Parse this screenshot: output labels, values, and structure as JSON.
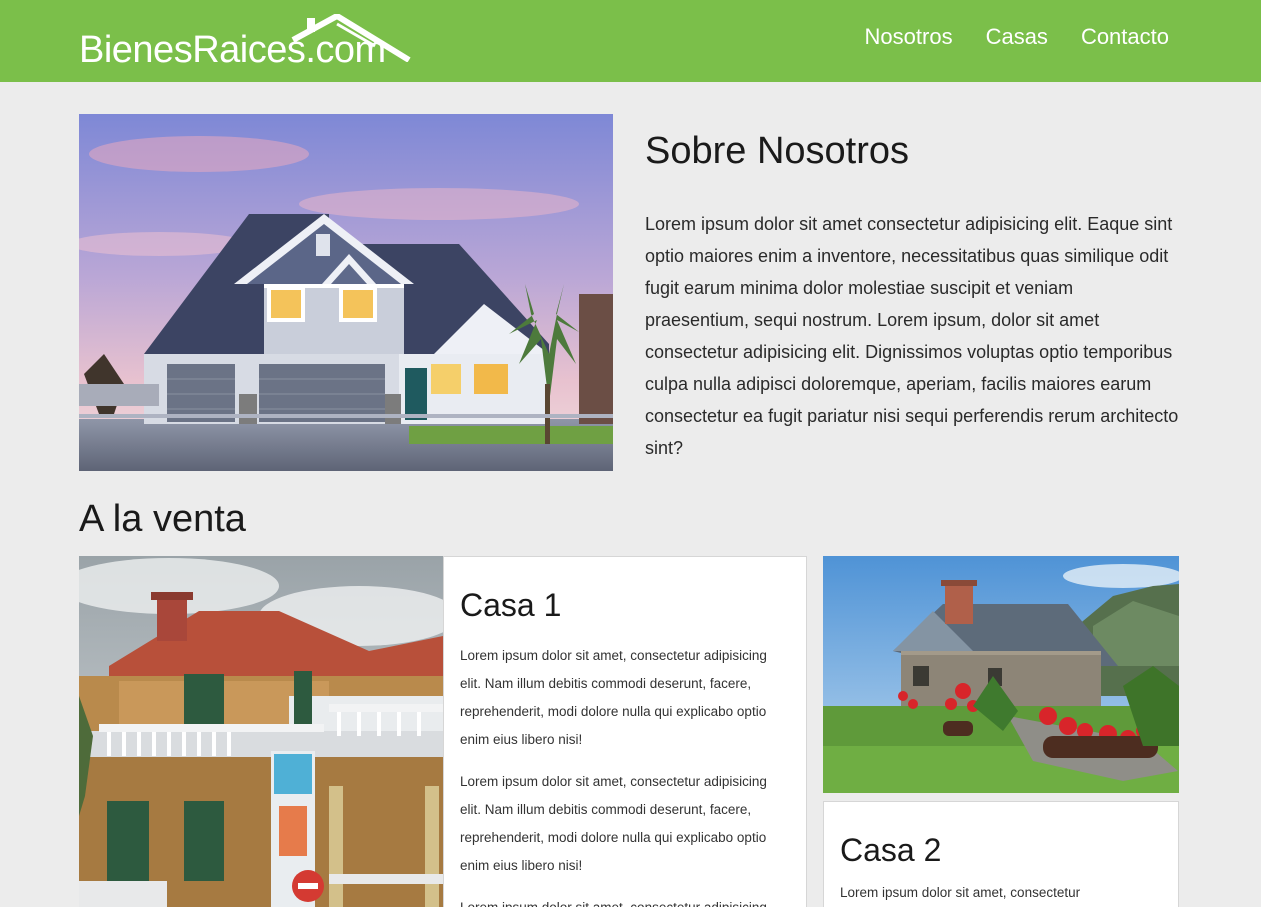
{
  "header": {
    "logo_text": "BienesRaices.com",
    "nav": [
      "Nosotros",
      "Casas",
      "Contacto"
    ]
  },
  "about": {
    "title": "Sobre Nosotros",
    "text": "Lorem ipsum dolor sit amet consectetur adipisicing elit. Eaque sint optio maiores enim a inventore, necessitatibus quas similique odit fugit earum minima dolor molestiae suscipit et veniam praesentium, sequi nostrum. Lorem ipsum, dolor sit amet consectetur adipisicing elit. Dignissimos voluptas optio temporibus culpa nulla adipisci doloremque, aperiam, facilis maiores earum consectetur ea fugit pariatur nisi sequi perferendis rerum architecto sint?"
  },
  "sale": {
    "title": "A la venta",
    "cards": [
      {
        "title": "Casa 1",
        "paragraphs": [
          "Lorem ipsum dolor sit amet, consectetur adipisicing elit. Nam illum debitis commodi deserunt, facere, reprehenderit, modi dolore nulla qui explicabo optio enim eius libero nisi!",
          "Lorem ipsum dolor sit amet, consectetur adipisicing elit. Nam illum debitis commodi deserunt, facere, reprehenderit, modi dolore nulla qui explicabo optio enim eius libero nisi!",
          "Lorem ipsum dolor sit amet, consectetur adipisicing"
        ]
      },
      {
        "title": "Casa 2",
        "paragraphs": [
          "Lorem ipsum dolor sit amet, consectetur"
        ]
      }
    ]
  },
  "colors": {
    "header_bg": "#7bbf4a",
    "page_bg": "#ececec",
    "card_bg": "#ffffff"
  }
}
